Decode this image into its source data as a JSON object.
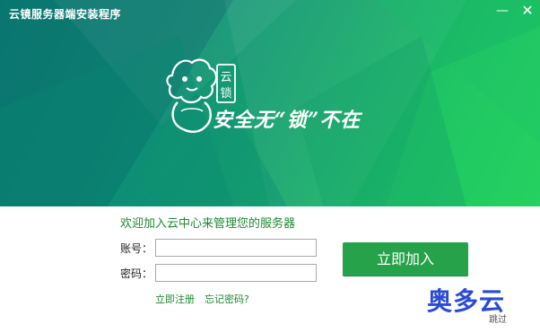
{
  "window": {
    "title": "云镜服务器端安装程序",
    "minimize_glyph": "—",
    "close_glyph": "✕"
  },
  "banner": {
    "logo_text": "云锁",
    "slogan": "安全无“锁”不在"
  },
  "form": {
    "welcome": "欢迎加入云中心来管理您的服务器",
    "account_label": "账号：",
    "account_value": "",
    "password_label": "密码：",
    "password_value": "",
    "register_link": "立即注册",
    "forgot_link": "忘记密码?",
    "join_button": "立即加入",
    "skip_link": "跳过"
  },
  "watermark": {
    "text": "奥多云"
  },
  "colors": {
    "banner_start": "#0a7d77",
    "banner_end": "#23cf5e",
    "accent_green": "#25a24a",
    "link_green": "#1a8a2e",
    "watermark_blue": "#2b4bd6"
  },
  "icons": {
    "logo": "lion-lock-mascot-icon"
  }
}
